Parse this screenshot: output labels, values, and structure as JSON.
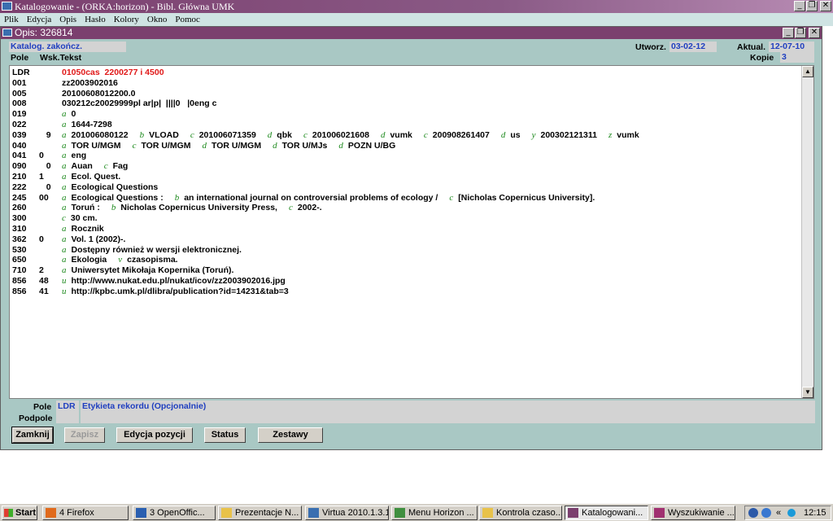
{
  "app": {
    "title": "Katalogowanie - (ORKA:horizon) - Bibl. Główna UMK",
    "window_buttons": [
      "_",
      "❐",
      "✕"
    ]
  },
  "menu": [
    "Plik",
    "Edycja",
    "Opis",
    "Hasło",
    "Kolory",
    "Okno",
    "Pomoc"
  ],
  "child": {
    "title": "Opis: 326814",
    "status_value": "Katalog. zakończ.",
    "created_label": "Utworz.",
    "created_value": "03-02-12",
    "updated_label": "Aktual.",
    "updated_value": "12-07-10",
    "copies_label": "Kopie",
    "copies_value": "3",
    "col_pole": "Pole",
    "col_wsk": "Wsk.Tekst"
  },
  "marc": [
    {
      "tag": "LDR",
      "ind": "",
      "parts": [
        {
          "t": "01050cas  2200277 i 4500",
          "cls": "red"
        }
      ]
    },
    {
      "tag": "001",
      "ind": "",
      "parts": [
        {
          "t": "zz2003902016"
        }
      ]
    },
    {
      "tag": "005",
      "ind": "",
      "parts": [
        {
          "t": "20100608012200.0"
        }
      ]
    },
    {
      "tag": "008",
      "ind": "",
      "parts": [
        {
          "t": "030212c20029999pl ar|p|  ||||0   |0eng c"
        }
      ]
    },
    {
      "tag": "019",
      "ind": "",
      "parts": [
        {
          "s": "a"
        },
        {
          "t": "0"
        }
      ]
    },
    {
      "tag": "022",
      "ind": "",
      "parts": [
        {
          "s": "a"
        },
        {
          "t": "1644-7298"
        }
      ]
    },
    {
      "tag": "039",
      "ind": "   9",
      "parts": [
        {
          "s": "a"
        },
        {
          "t": "201006080122"
        },
        {
          "s": "b"
        },
        {
          "t": "VLOAD"
        },
        {
          "s": "c"
        },
        {
          "t": "201006071359"
        },
        {
          "s": "d"
        },
        {
          "t": "qbk"
        },
        {
          "s": "c"
        },
        {
          "t": "201006021608"
        },
        {
          "s": "d"
        },
        {
          "t": "vumk"
        },
        {
          "s": "c"
        },
        {
          "t": "200908261407"
        },
        {
          "s": "d"
        },
        {
          "t": "us"
        },
        {
          "s": "y"
        },
        {
          "t": "200302121311"
        },
        {
          "s": "z"
        },
        {
          "t": "vumk"
        }
      ]
    },
    {
      "tag": "040",
      "ind": "",
      "parts": [
        {
          "s": "a"
        },
        {
          "t": "TOR U/MGM"
        },
        {
          "s": "c"
        },
        {
          "t": "TOR U/MGM"
        },
        {
          "s": "d"
        },
        {
          "t": "TOR U/MGM"
        },
        {
          "s": "d"
        },
        {
          "t": "TOR U/MJs"
        },
        {
          "s": "d"
        },
        {
          "t": "POZN U/BG"
        }
      ]
    },
    {
      "tag": "041",
      "ind": "0",
      "parts": [
        {
          "s": "a"
        },
        {
          "t": "eng"
        }
      ]
    },
    {
      "tag": "090",
      "ind": "   0",
      "parts": [
        {
          "s": "a"
        },
        {
          "t": "Auan"
        },
        {
          "s": "c"
        },
        {
          "t": "Fag"
        }
      ]
    },
    {
      "tag": "210",
      "ind": "1",
      "parts": [
        {
          "s": "a"
        },
        {
          "t": "Ecol. Quest."
        }
      ]
    },
    {
      "tag": "222",
      "ind": "   0",
      "parts": [
        {
          "s": "a"
        },
        {
          "t": "Ecological Questions"
        }
      ]
    },
    {
      "tag": "245",
      "ind": "00",
      "parts": [
        {
          "s": "a"
        },
        {
          "t": "Ecological Questions :"
        },
        {
          "s": "b"
        },
        {
          "t": "an international journal on controversial problems of ecology /"
        },
        {
          "s": "c"
        },
        {
          "t": "[Nicholas Copernicus University]."
        }
      ]
    },
    {
      "tag": "260",
      "ind": "",
      "parts": [
        {
          "s": "a"
        },
        {
          "t": "Toruń :"
        },
        {
          "s": "b"
        },
        {
          "t": "Nicholas Copernicus University Press,"
        },
        {
          "s": "c"
        },
        {
          "t": "2002-."
        }
      ]
    },
    {
      "tag": "300",
      "ind": "",
      "parts": [
        {
          "s": "c"
        },
        {
          "t": "30 cm."
        }
      ]
    },
    {
      "tag": "310",
      "ind": "",
      "parts": [
        {
          "s": "a"
        },
        {
          "t": "Rocznik"
        }
      ]
    },
    {
      "tag": "362",
      "ind": "0",
      "parts": [
        {
          "s": "a"
        },
        {
          "t": "Vol. 1 (2002)-."
        }
      ]
    },
    {
      "tag": "530",
      "ind": "",
      "parts": [
        {
          "s": "a"
        },
        {
          "t": "Dostępny również w wersji elektronicznej."
        }
      ]
    },
    {
      "tag": "650",
      "ind": "",
      "parts": [
        {
          "s": "a"
        },
        {
          "t": "Ekologia"
        },
        {
          "s": "v"
        },
        {
          "t": "czasopisma."
        }
      ]
    },
    {
      "tag": "710",
      "ind": "2",
      "parts": [
        {
          "s": "a"
        },
        {
          "t": "Uniwersytet Mikołaja Kopernika (Toruń)."
        }
      ]
    },
    {
      "tag": "856",
      "ind": "48",
      "parts": [
        {
          "s": "u"
        },
        {
          "t": "http://www.nukat.edu.pl/nukat/icov/zz2003902016.jpg"
        }
      ]
    },
    {
      "tag": "856",
      "ind": "41",
      "parts": [
        {
          "s": "u"
        },
        {
          "t": "http://kpbc.umk.pl/dlibra/publication?id=14231&tab=3"
        }
      ]
    }
  ],
  "footer": {
    "pole_label": "Pole",
    "podpole_label": "Podpole",
    "pole_value": "LDR",
    "description": "Etykieta rekordu (Opcjonalnie)"
  },
  "buttons": {
    "close": "Zamknij",
    "save": "Zapisz",
    "edit_item": "Edycja pozycji",
    "status": "Status",
    "sets": "Zestawy"
  },
  "taskbar": {
    "start": "Start",
    "items": [
      "4 Firefox",
      "3 OpenOffic...",
      "Prezentacje N...",
      "Virtua 2010.1.3.1",
      "Menu Horizon ...",
      "Kontrola czaso...",
      "Katalogowani...",
      "Wyszukiwanie ..."
    ],
    "clock": "12:15",
    "tray_chevron": "«"
  },
  "colors": {
    "title_bg": "#7b3f6e",
    "window_bg": "#a9c8c4",
    "subfield": "#1e8a1e",
    "leader": "#e01818",
    "header_value": "#1f3fc0"
  }
}
